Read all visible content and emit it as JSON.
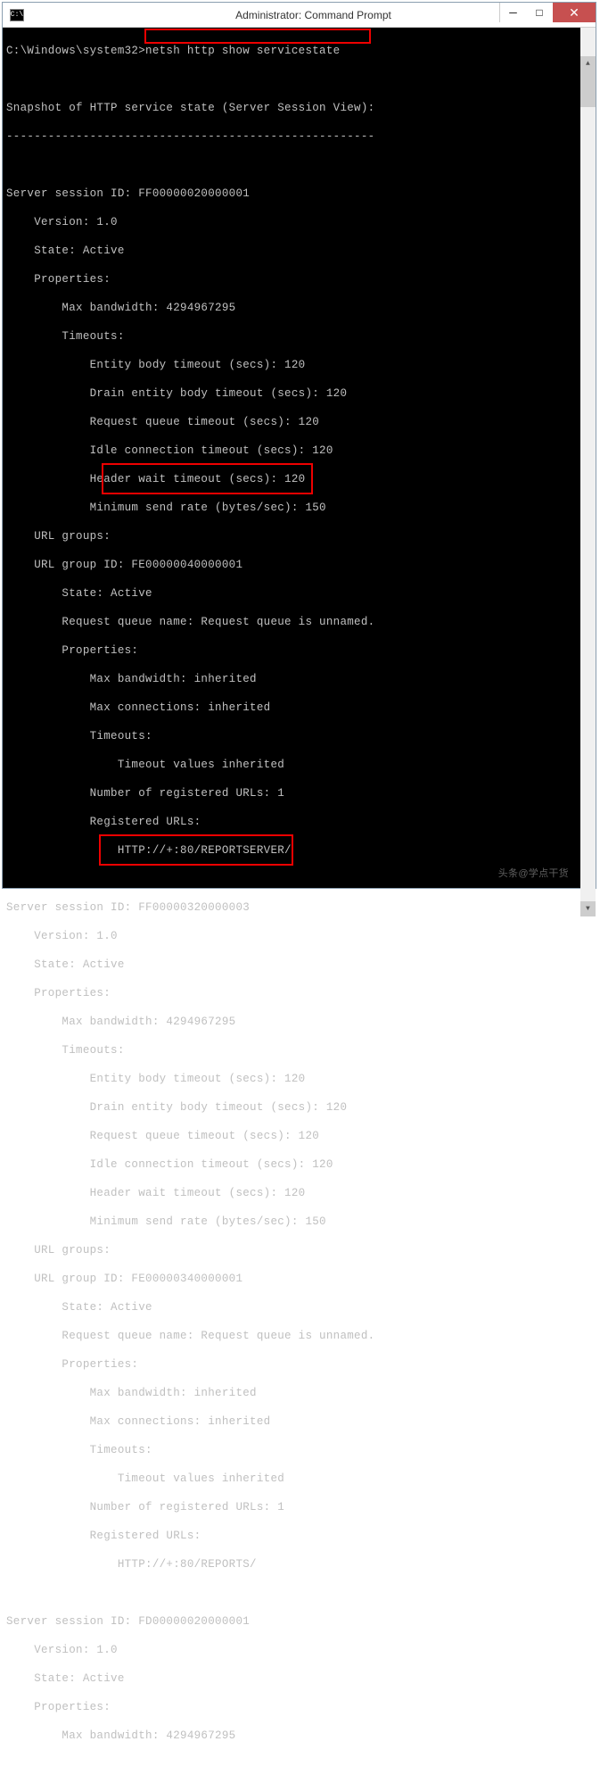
{
  "window": {
    "title": "Administrator: Command Prompt"
  },
  "prompt": {
    "path": "C:\\Windows\\system32>",
    "command": "netsh http show servicestate"
  },
  "output": {
    "snapshot_header": "Snapshot of HTTP service state (Server Session View):",
    "divider": "-----------------------------------------------------",
    "session1": {
      "header": "Server session ID: FF00000020000001",
      "version": "    Version: 1.0",
      "state": "    State: Active",
      "props": "    Properties:",
      "maxbw": "        Max bandwidth: 4294967295",
      "timeouts": "        Timeouts:",
      "ebt": "            Entity body timeout (secs): 120",
      "debt": "            Drain entity body timeout (secs): 120",
      "rqt": "            Request queue timeout (secs): 120",
      "ict": "            Idle connection timeout (secs): 120",
      "hwt": "            Header wait timeout (secs): 120",
      "msr": "            Minimum send rate (bytes/sec): 150",
      "urlgroups": "    URL groups:",
      "urlgid": "    URL group ID: FE00000040000001",
      "gstate": "        State: Active",
      "rqn": "        Request queue name: Request queue is unnamed.",
      "gprops": "        Properties:",
      "gmaxbw": "            Max bandwidth: inherited",
      "gmaxconn": "            Max connections: inherited",
      "gtimeouts": "            Timeouts:",
      "gtvi": "                Timeout values inherited",
      "numreg": "            Number of registered URLs: 1",
      "regurls": "            Registered URLs:",
      "url": "                HTTP://+:80/REPORTSERVER/"
    },
    "session2": {
      "header": "Server session ID: FF00000320000003",
      "version": "    Version: 1.0",
      "state": "    State: Active",
      "props": "    Properties:",
      "maxbw": "        Max bandwidth: 4294967295",
      "timeouts": "        Timeouts:",
      "ebt": "            Entity body timeout (secs): 120",
      "debt": "            Drain entity body timeout (secs): 120",
      "rqt": "            Request queue timeout (secs): 120",
      "ict": "            Idle connection timeout (secs): 120",
      "hwt": "            Header wait timeout (secs): 120",
      "msr": "            Minimum send rate (bytes/sec): 150",
      "urlgroups": "    URL groups:",
      "urlgid": "    URL group ID: FE00000340000001",
      "gstate": "        State: Active",
      "rqn": "        Request queue name: Request queue is unnamed.",
      "gprops": "        Properties:",
      "gmaxbw": "            Max bandwidth: inherited",
      "gmaxconn": "            Max connections: inherited",
      "gtimeouts": "            Timeouts:",
      "gtvi": "                Timeout values inherited",
      "numreg": "            Number of registered URLs: 1",
      "regurls": "            Registered URLs:",
      "url": "                HTTP://+:80/REPORTS/"
    },
    "session3": {
      "header": "Server session ID: FD00000020000001",
      "version": "    Version: 1.0",
      "state": "    State: Active",
      "props": "    Properties:",
      "maxbw": "        Max bandwidth: 4294967295"
    }
  },
  "watermark": "头条@学点干货"
}
